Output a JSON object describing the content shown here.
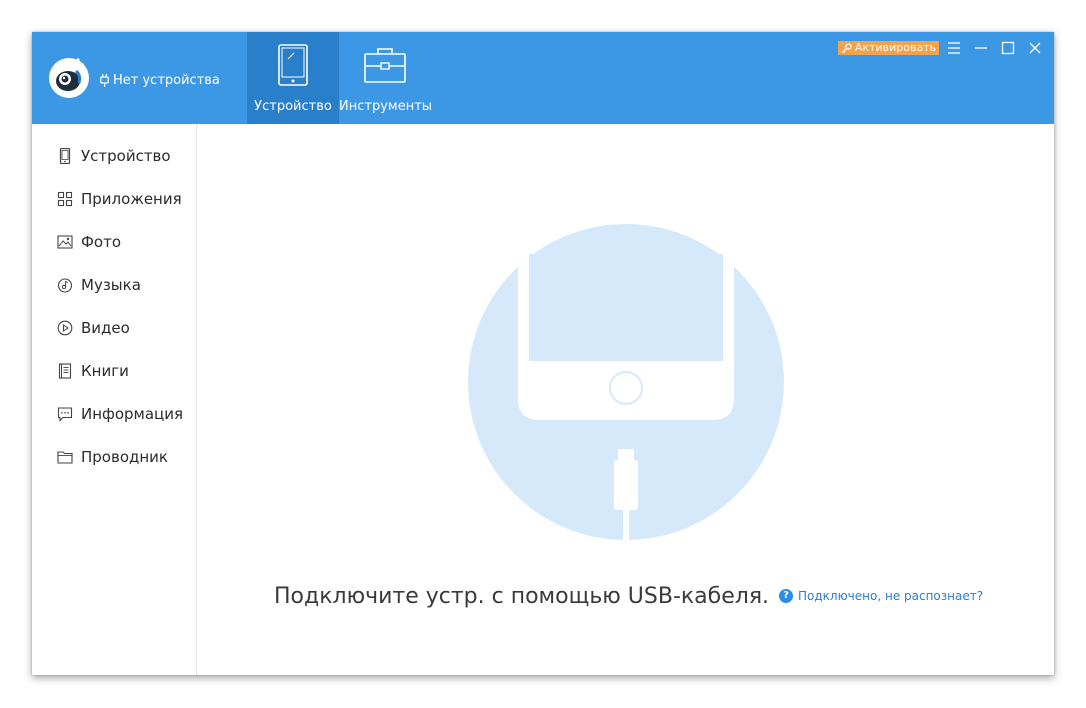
{
  "header": {
    "device_status": "Нет устройства",
    "tabs": [
      {
        "label": "Устройство",
        "icon": "phone-icon",
        "active": true
      },
      {
        "label": "Инструменты",
        "icon": "toolbox-icon",
        "active": false
      }
    ],
    "activate_label": "Активировать"
  },
  "sidebar": {
    "items": [
      {
        "label": "Устройство",
        "icon": "device-icon"
      },
      {
        "label": "Приложения",
        "icon": "apps-grid-icon"
      },
      {
        "label": "Фото",
        "icon": "photo-icon"
      },
      {
        "label": "Музыка",
        "icon": "music-icon"
      },
      {
        "label": "Видео",
        "icon": "video-icon"
      },
      {
        "label": "Книги",
        "icon": "book-icon"
      },
      {
        "label": "Информация",
        "icon": "message-icon"
      },
      {
        "label": "Проводник",
        "icon": "folder-icon"
      }
    ]
  },
  "main": {
    "connect_message": "Подключите устр. с помощью USB-кабеля.",
    "help_link": "Подключено, не распознает?"
  },
  "colors": {
    "header_bg": "#3c98e4",
    "active_tab_bg": "#2a7fca",
    "activate_bg": "#f5a24a",
    "illustration_circle": "#d6e9fb",
    "link": "#2a7fca"
  }
}
